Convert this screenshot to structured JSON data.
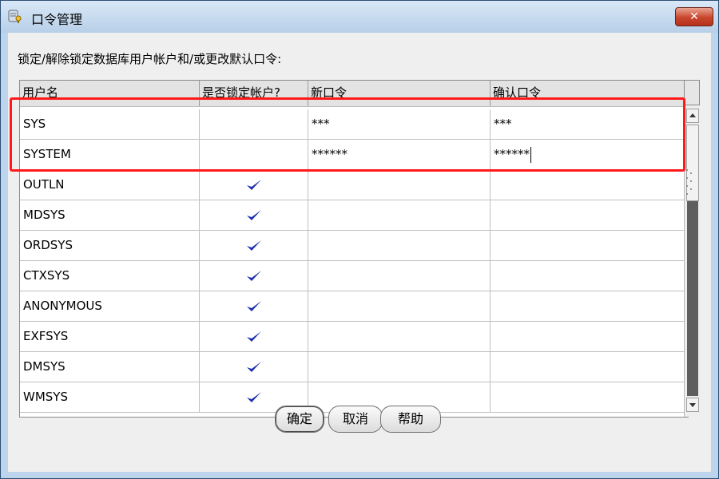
{
  "window": {
    "title": "口令管理",
    "close_label": "✕"
  },
  "description": "锁定/解除锁定数据库用户帐户和/或更改默认口令:",
  "table": {
    "columns": [
      "用户名",
      "是否锁定帐户?",
      "新口令",
      "确认口令"
    ],
    "rows": [
      {
        "user": "SYS",
        "locked": false,
        "new_password": "***",
        "confirm_password": "***"
      },
      {
        "user": "SYSTEM",
        "locked": false,
        "new_password": "******",
        "confirm_password": "******"
      },
      {
        "user": "OUTLN",
        "locked": true,
        "new_password": "",
        "confirm_password": ""
      },
      {
        "user": "MDSYS",
        "locked": true,
        "new_password": "",
        "confirm_password": ""
      },
      {
        "user": "ORDSYS",
        "locked": true,
        "new_password": "",
        "confirm_password": ""
      },
      {
        "user": "CTXSYS",
        "locked": true,
        "new_password": "",
        "confirm_password": ""
      },
      {
        "user": "ANONYMOUS",
        "locked": true,
        "new_password": "",
        "confirm_password": ""
      },
      {
        "user": "EXFSYS",
        "locked": true,
        "new_password": "",
        "confirm_password": ""
      },
      {
        "user": "DMSYS",
        "locked": true,
        "new_password": "",
        "confirm_password": ""
      },
      {
        "user": "WMSYS",
        "locked": true,
        "new_password": "",
        "confirm_password": ""
      }
    ]
  },
  "buttons": {
    "ok": "确定",
    "cancel": "取消",
    "help": "帮助"
  },
  "colors": {
    "highlight": "#ff1a1a",
    "checkmark": "#1a2fb0",
    "close_button": "#c8452c"
  }
}
